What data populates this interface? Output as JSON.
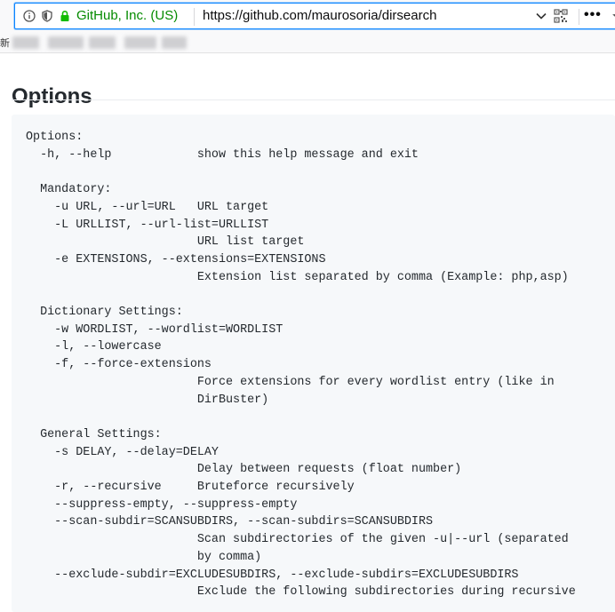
{
  "browser": {
    "site_identity": "GitHub, Inc. (US)",
    "url": "https://github.com/maurosoria/dirsearch"
  },
  "bookmarks": {
    "first_char": "新"
  },
  "page": {
    "heading": "Options",
    "code_lines": [
      "Options:",
      "  -h, --help            show this help message and exit",
      "",
      "  Mandatory:",
      "    -u URL, --url=URL   URL target",
      "    -L URLLIST, --url-list=URLLIST",
      "                        URL list target",
      "    -e EXTENSIONS, --extensions=EXTENSIONS",
      "                        Extension list separated by comma (Example: php,asp)",
      "",
      "  Dictionary Settings:",
      "    -w WORDLIST, --wordlist=WORDLIST",
      "    -l, --lowercase",
      "    -f, --force-extensions",
      "                        Force extensions for every wordlist entry (like in",
      "                        DirBuster)",
      "",
      "  General Settings:",
      "    -s DELAY, --delay=DELAY",
      "                        Delay between requests (float number)",
      "    -r, --recursive     Bruteforce recursively",
      "    --suppress-empty, --suppress-empty",
      "    --scan-subdir=SCANSUBDIRS, --scan-subdirs=SCANSUBDIRS",
      "                        Scan subdirectories of the given -u|--url (separated",
      "                        by comma)",
      "    --exclude-subdir=EXCLUDESUBDIRS, --exclude-subdirs=EXCLUDESUBDIRS",
      "                        Exclude the following subdirectories during recursive"
    ]
  },
  "colors": {
    "secure_green": "#058b00",
    "focus_blue": "#0a84ff",
    "code_bg": "#f6f8fa",
    "text": "#24292e"
  },
  "icons": [
    "info-icon",
    "shield-icon",
    "lock-icon",
    "chevron-down-icon",
    "qr-code-icon",
    "more-icon",
    "star-icon"
  ]
}
